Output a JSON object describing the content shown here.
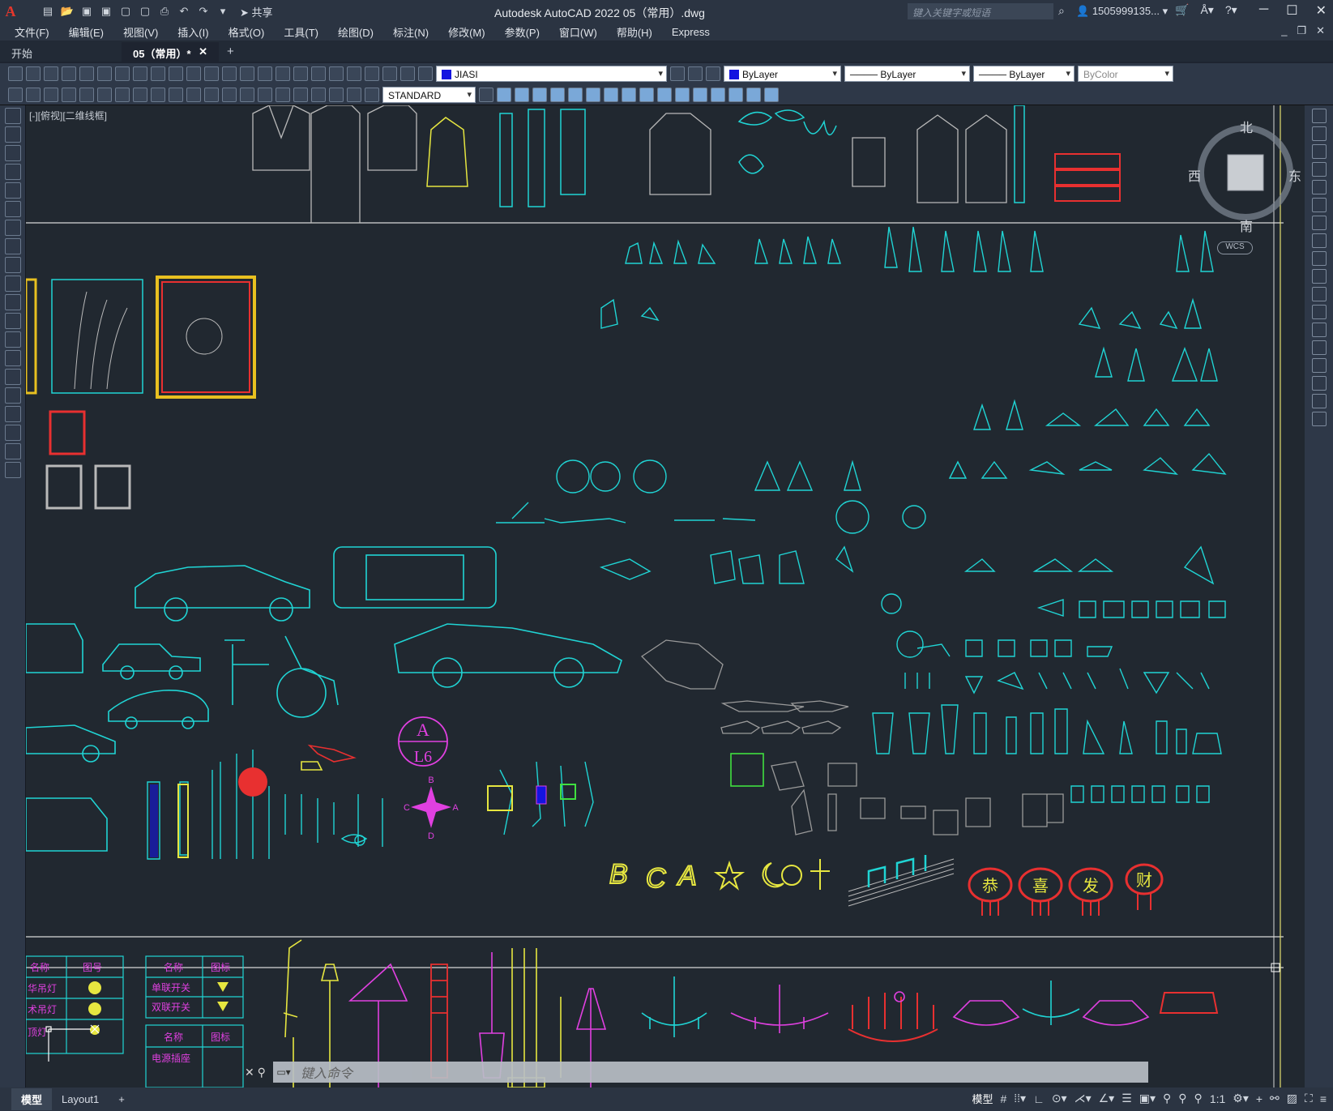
{
  "titlebar": {
    "share_label": "共享",
    "title": "Autodesk AutoCAD 2022    05（常用）.dwg",
    "search_placeholder": "键入关键字或短语",
    "user": "1505999135..."
  },
  "menu": [
    "文件(F)",
    "编辑(E)",
    "视图(V)",
    "插入(I)",
    "格式(O)",
    "工具(T)",
    "绘图(D)",
    "标注(N)",
    "修改(M)",
    "参数(P)",
    "窗口(W)",
    "帮助(H)",
    "Express"
  ],
  "tabs": {
    "start": "开始",
    "active": "05（常用）*",
    "close": "✕",
    "add": "+"
  },
  "toolbar": {
    "layer": "JIASI",
    "layer_color": "#1414e0",
    "color": "ByLayer",
    "linetype": "ByLayer",
    "lineweight": "ByLayer",
    "plotstyle": "ByColor",
    "textstyle": "STANDARD"
  },
  "canvas": {
    "view_label": "[-][俯视][二维线框]",
    "compass": {
      "n": "北",
      "s": "南",
      "e": "东",
      "w": "西"
    },
    "wcs": "WCS",
    "labels": {
      "a_circle_top": "A",
      "a_circle_bottom": "L6",
      "compass_star": [
        "B",
        "C",
        "A",
        "D"
      ],
      "letters": [
        "B",
        "C",
        "A"
      ],
      "lanterns": [
        "恭",
        "喜",
        "发",
        "财"
      ],
      "legend1_headers": [
        "名称",
        "图号"
      ],
      "legend1_rows": [
        "华吊灯",
        "术吊灯",
        "顶灯"
      ],
      "legend2_headers": [
        "名称",
        "图标"
      ],
      "legend2_rows": [
        "单联开关",
        "双联开关"
      ],
      "legend3_headers": [
        "名称",
        "图标"
      ],
      "legend3_rows": [
        "电源插座"
      ]
    }
  },
  "command": {
    "prompt": "键入命令"
  },
  "status": {
    "model_tab": "模型",
    "layout_tab": "Layout1",
    "add_tab": "+",
    "model_label": "模型",
    "scale": "1:1"
  }
}
